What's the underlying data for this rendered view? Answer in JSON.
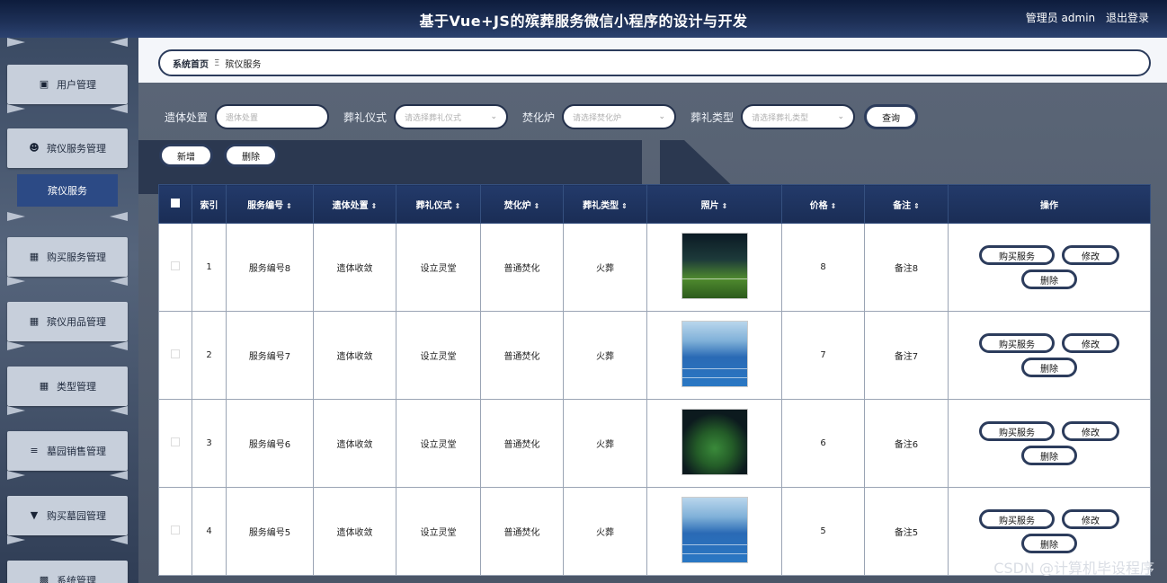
{
  "header": {
    "title": "基于Vue+JS的殡葬服务微信小程序的设计与开发",
    "user_label": "管理员 admin",
    "logout_label": "退出登录"
  },
  "sidebar": {
    "items": [
      {
        "label": "用户管理",
        "icon": "briefcase-icon"
      },
      {
        "label": "殡仪服务管理",
        "icon": "user-icon"
      },
      {
        "label": "购买服务管理",
        "icon": "chart-icon"
      },
      {
        "label": "殡仪用品管理",
        "icon": "grid-icon"
      },
      {
        "label": "类型管理",
        "icon": "grid-icon"
      },
      {
        "label": "墓园销售管理",
        "icon": "sliders-icon"
      },
      {
        "label": "购买墓园管理",
        "icon": "trophy-icon"
      },
      {
        "label": "系统管理",
        "icon": "bars-icon"
      }
    ],
    "active_sub": "殡仪服务"
  },
  "breadcrumb": {
    "home": "系统首页",
    "separator": "Ξ",
    "current": "殡仪服务"
  },
  "filters": [
    {
      "label": "遗体处置",
      "placeholder": "遗体处置",
      "type": "input"
    },
    {
      "label": "葬礼仪式",
      "placeholder": "请选择葬礼仪式",
      "type": "select"
    },
    {
      "label": "焚化炉",
      "placeholder": "请选择焚化炉",
      "type": "select"
    },
    {
      "label": "葬礼类型",
      "placeholder": "请选择葬礼类型",
      "type": "select"
    }
  ],
  "buttons": {
    "query": "查询",
    "add": "新增",
    "delete": "删除",
    "buy": "购买服务",
    "edit": "修改",
    "row_delete": "删除"
  },
  "table": {
    "columns": [
      "索引",
      "服务编号",
      "遗体处置",
      "葬礼仪式",
      "焚化炉",
      "葬礼类型",
      "照片",
      "价格",
      "备注",
      "操作"
    ],
    "rows": [
      {
        "index": "1",
        "code": "服务编号8",
        "disposal": "遗体收敛",
        "ceremony": "设立灵堂",
        "furnace": "普通焚化",
        "type": "火葬",
        "photo": "night-stadium-photo",
        "price": "8",
        "note": "备注8"
      },
      {
        "index": "2",
        "code": "服务编号7",
        "disposal": "遗体收敛",
        "ceremony": "设立灵堂",
        "furnace": "普通焚化",
        "type": "火葬",
        "photo": "blue-court-photo",
        "price": "7",
        "note": "备注7"
      },
      {
        "index": "3",
        "code": "服务编号6",
        "disposal": "遗体收敛",
        "ceremony": "设立灵堂",
        "furnace": "普通焚化",
        "type": "火葬",
        "photo": "dark-stadium-photo",
        "price": "6",
        "note": "备注6"
      },
      {
        "index": "4",
        "code": "服务编号5",
        "disposal": "遗体收敛",
        "ceremony": "设立灵堂",
        "furnace": "普通焚化",
        "type": "火葬",
        "photo": "blue-court-photo",
        "price": "5",
        "note": "备注5"
      }
    ]
  },
  "watermark": "CSDN @计算机毕设程序"
}
